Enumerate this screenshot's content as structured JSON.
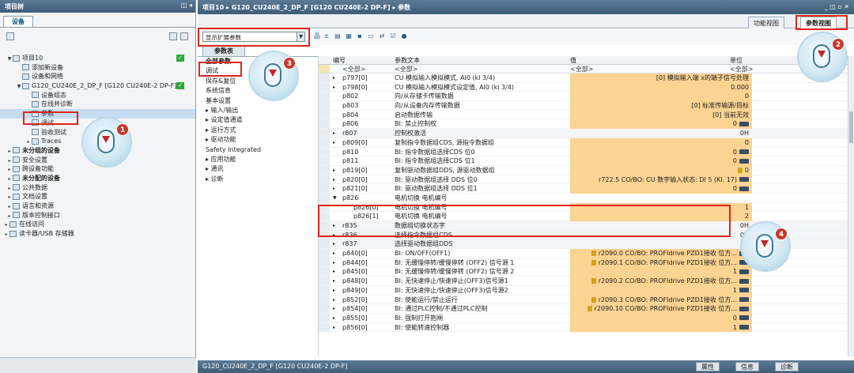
{
  "left_panel": {
    "title": "项目树",
    "tab": "设备",
    "tree": [
      {
        "label": "项目10",
        "level": 0,
        "toggle": "▼",
        "check": "✓"
      },
      {
        "label": "添加新设备",
        "level": 1,
        "toggle": ""
      },
      {
        "label": "设备和网络",
        "level": 1,
        "toggle": ""
      },
      {
        "label": "G120_CU240E_2_DP_F [G120 CU240E-2 DP-F]",
        "level": 1,
        "toggle": "▼",
        "check": "✓"
      },
      {
        "label": "设备组态",
        "level": 2,
        "toggle": ""
      },
      {
        "label": "在线并诊断",
        "level": 2,
        "toggle": ""
      },
      {
        "label": "参数",
        "level": 2,
        "toggle": "",
        "selected": true
      },
      {
        "label": "调试",
        "level": 2,
        "toggle": ""
      },
      {
        "label": "验收测试",
        "level": 2,
        "toggle": ""
      },
      {
        "label": "Traces",
        "level": 2,
        "toggle": "▸"
      },
      {
        "label": "未分组的设备",
        "level": 0,
        "toggle": "▸",
        "bold": true
      },
      {
        "label": "安全设置",
        "level": 0,
        "toggle": "▸"
      },
      {
        "label": "跨设备功能",
        "level": 0,
        "toggle": "▸"
      },
      {
        "label": "未分配的设备",
        "level": 0,
        "toggle": "▸",
        "bold": true
      },
      {
        "label": "公共数据",
        "level": 0,
        "toggle": "▸"
      },
      {
        "label": "文档设置",
        "level": 0,
        "toggle": "▸"
      },
      {
        "label": "语言和资源",
        "level": 0,
        "toggle": "▸"
      },
      {
        "label": "版本控制接口",
        "level": 0,
        "toggle": "▸"
      },
      {
        "label": "在线访问",
        "level": -1,
        "toggle": "▸"
      },
      {
        "label": "读卡器/USB 存储器",
        "level": -1,
        "toggle": "▸"
      }
    ]
  },
  "editor": {
    "title": "项目10 ▸ G120_CU240E_2_DP_F [G120 CU240E-2 DP-F] ▸ 参数",
    "view_tabs": [
      "功能视图",
      "参数视图"
    ],
    "filter_select": "显示扩展参数",
    "param_tab": "参数表",
    "nav": [
      "全部参数",
      "调试",
      "保存&复位",
      "系统信息",
      "基本设置",
      "▸ 输入/输出",
      "▸ 设定值通道",
      "▸ 运行方式",
      "▸ 驱动功能",
      "Safety Integrated",
      "▸ 应用功能",
      "▸ 通讯",
      "▸ 诊断"
    ],
    "columns": {
      "num": "编号",
      "text": "参数文本",
      "value": "值",
      "unit": "单位"
    },
    "filter": {
      "num": "<全部>",
      "text": "<全部>",
      "value": "<全部>",
      "unit": "<全部>"
    },
    "rows": [
      {
        "num": "p797[0]",
        "text": "CU 模拟输入模拟模式, AI0 (kl 3/4)",
        "value": "[0] 模拟输入端 x的端子信号处理",
        "style": "o",
        "tw": "▸"
      },
      {
        "num": "p798[0]",
        "text": "CU 模拟输入模拟模式设定值, AI0 (kl 3/4)",
        "value": "0.000",
        "style": "o",
        "tw": "▸"
      },
      {
        "num": "p802",
        "text": "向/从存储卡传输数据",
        "value": "0",
        "style": "o",
        "tw": ""
      },
      {
        "num": "p803",
        "text": "向/从设备内存传输数据",
        "value": "[0] 标准传输源/目标",
        "style": "o",
        "tw": ""
      },
      {
        "num": "p804",
        "text": "启动数据传输",
        "value": "[0] 当前无效",
        "style": "o",
        "tw": ""
      },
      {
        "num": "p806",
        "text": "BI: 禁止控制权",
        "value": "0",
        "style": "o",
        "tw": "",
        "drop": true
      },
      {
        "num": "r807",
        "text": "控制权激活",
        "value": "0H",
        "style": "",
        "tw": "▸"
      },
      {
        "num": "p809[0]",
        "text": "复制指令数据组CDS, 源指令数据组",
        "value": "0",
        "style": "o",
        "tw": "▸"
      },
      {
        "num": "p810",
        "text": "BI: 指令数据组选择CDS 位0",
        "value": "0",
        "style": "o",
        "tw": "",
        "drop": true
      },
      {
        "num": "p811",
        "text": "BI: 指令数据组选择CDS 位1",
        "value": "0",
        "style": "o",
        "tw": "",
        "drop": true
      },
      {
        "num": "p819[0]",
        "text": "复制驱动数据组DDS, 源驱动数据组",
        "value": "0",
        "style": "o",
        "tw": "▸",
        "lock": true
      },
      {
        "num": "p820[0]",
        "text": "BI: 驱动数据组选择 DDS 位0",
        "value": "r722.5 CO/BO: CU 数字输入状态: DI 5 (Kl. 17)",
        "style": "o",
        "tw": "▸",
        "drop": true
      },
      {
        "num": "p821[0]",
        "text": "BI: 驱动数据组选择 DDS 位1",
        "value": "0",
        "style": "o",
        "tw": "▸",
        "drop": true
      },
      {
        "num": "p826",
        "text": "电机切换 电机编号",
        "value": "",
        "style": "o2",
        "tw": "▼"
      },
      {
        "num": "p826[0]",
        "text": "电机切换 电机编号",
        "value": "1",
        "style": "o",
        "tw": "",
        "indent": true
      },
      {
        "num": "p826[1]",
        "text": "电机切换 电机编号",
        "value": "2",
        "style": "o",
        "tw": "",
        "indent": true
      },
      {
        "num": "r835",
        "text": "数据组切换状态字",
        "value": "0H",
        "style": "",
        "tw": "▸"
      },
      {
        "num": "r836",
        "text": "选择指令数据组CDS",
        "value": "0H",
        "style": "",
        "tw": "▸"
      },
      {
        "num": "r837",
        "text": "选择驱动数据组DDS",
        "value": "0H",
        "style": "",
        "tw": "▸"
      },
      {
        "num": "p840[0]",
        "text": "BI: ON/OFF(OFF1)",
        "value": "r2090.0 CO/BO: PROFIdrive PZD1接收 位方...",
        "style": "o",
        "tw": "▸",
        "drop": true,
        "lock": true
      },
      {
        "num": "p844[0]",
        "text": "BI: 无缓慢停转/缓慢停转 (OFF2) 信号源 1",
        "value": "r2090.1 CO/BO: PROFIdrive PZD1接收 位方...",
        "style": "o",
        "tw": "▸",
        "drop": true,
        "lock": true
      },
      {
        "num": "p845[0]",
        "text": "BI: 无缓慢停转/缓慢停转 (OFF2) 信号源 2",
        "value": "1",
        "style": "o",
        "tw": "▸",
        "drop": true
      },
      {
        "num": "p848[0]",
        "text": "BI: 无快速停止/快速停止(OFF3)信号源1",
        "value": "r2090.2 CO/BO: PROFIdrive PZD1接收 位方...",
        "style": "o",
        "tw": "▸",
        "drop": true,
        "lock": true
      },
      {
        "num": "p849[0]",
        "text": "BI: 无快速停止/快速停止(OFF3)信号源2",
        "value": "1",
        "style": "o",
        "tw": "▸",
        "drop": true
      },
      {
        "num": "p852[0]",
        "text": "BI: 使能运行/禁止运行",
        "value": "r2090.3 CO/BO: PROFIdrive PZD1接收 位方...",
        "style": "o",
        "tw": "▸",
        "drop": true,
        "lock": true
      },
      {
        "num": "p854[0]",
        "text": "BI: 通过PLC控制/不通过PLC控制",
        "value": "r2090.10 CO/BO: PROFIdrive PZD1接收 位方...",
        "style": "o",
        "tw": "▸",
        "drop": true,
        "lock": true
      },
      {
        "num": "p855[0]",
        "text": "BI: 强制打开抱闸",
        "value": "0",
        "style": "o",
        "tw": "▸",
        "drop": true
      },
      {
        "num": "p856[0]",
        "text": "BI: 使能转速控制器",
        "value": "1",
        "style": "o",
        "tw": "▸",
        "drop": true
      }
    ]
  },
  "status_bar": {
    "device": "G120_CU240E_2_DP_F [G120 CU240E-2 DP-F]",
    "tabs": [
      "属性",
      "信息",
      "诊断"
    ]
  },
  "callouts": [
    "1",
    "2",
    "3",
    "4"
  ],
  "colors": {
    "highlight": "#e1251b",
    "value_bg": "#fbd392",
    "title_bg": "#4a6a86"
  }
}
